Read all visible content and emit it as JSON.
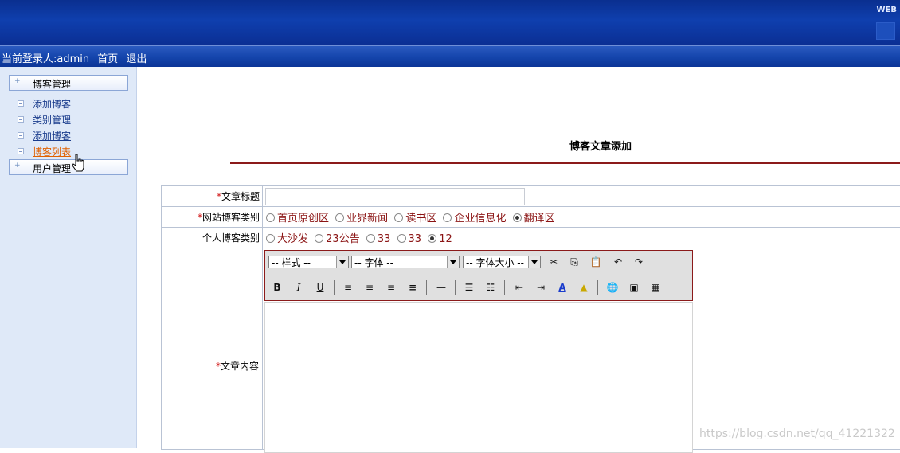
{
  "header": {
    "brand_text": "WEB"
  },
  "infobar": {
    "login_text": "当前登录人:admin",
    "home_link": "首页",
    "logout_link": "退出"
  },
  "sidebar": {
    "groups": [
      {
        "label": "博客管理",
        "items": [
          "添加博客",
          "类别管理",
          "添加博客",
          "博客列表"
        ]
      },
      {
        "label": "用户管理"
      }
    ],
    "active_item": "博客列表"
  },
  "page": {
    "title": "博客文章添加",
    "fields": {
      "title_label": "文章标题",
      "site_category_label": "网站博客类别",
      "site_categories": [
        "首页原创区",
        "业界新闻",
        "读书区",
        "企业信息化",
        "翻译区"
      ],
      "site_category_selected": "翻译区",
      "personal_category_label": "个人博客类别",
      "personal_categories": [
        "大沙发",
        "23公告",
        "33",
        "33",
        "12"
      ],
      "personal_category_selected": "12",
      "content_label": "文章内容",
      "required_mark": "*"
    },
    "editor": {
      "style_select": "-- 样式 --",
      "font_select": "-- 字体 --",
      "size_select": "-- 字体大小 --",
      "bold": "B",
      "italic": "I",
      "underline": "U"
    }
  },
  "watermark": "https://blog.csdn.net/qq_41221322",
  "colors": {
    "accent": "#8b1a1a",
    "header_blue": "#0f3fae",
    "sidebar_bg": "#dfe9f8",
    "active_link": "#e06000"
  }
}
